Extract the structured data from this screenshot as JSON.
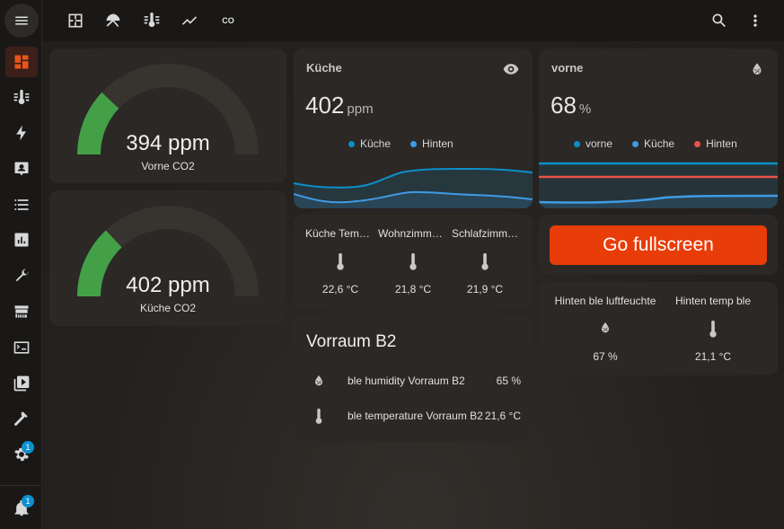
{
  "toolbar": {
    "icons": [
      "floorplan-icon",
      "umbrella-icon",
      "thermometer-icon",
      "chart-line-icon",
      "co2-icon",
      "search-icon",
      "more-vertical-icon"
    ],
    "co2_text": "CO"
  },
  "sidebar": {
    "items": [
      {
        "icon": "dashboard-icon",
        "active": true
      },
      {
        "icon": "thermometer-lines-icon"
      },
      {
        "icon": "energy-icon"
      },
      {
        "icon": "account-box-icon"
      },
      {
        "icon": "list-icon"
      },
      {
        "icon": "chart-box-icon"
      },
      {
        "icon": "wrench-icon"
      },
      {
        "icon": "hacs-store-icon"
      },
      {
        "icon": "console-icon"
      },
      {
        "icon": "media-icon"
      },
      {
        "icon": "hammer-icon"
      },
      {
        "icon": "settings-icon",
        "badge": "1"
      }
    ],
    "notifications": {
      "icon": "bell-icon",
      "badge": "1"
    }
  },
  "gauges": [
    {
      "value": "394 ppm",
      "name": "Vorne CO2",
      "fraction": 0.24
    },
    {
      "value": "402 ppm",
      "name": "Küche CO2",
      "fraction": 0.26
    }
  ],
  "graph_kueche": {
    "title": "Küche",
    "value": "402",
    "unit": "ppm",
    "legend": [
      {
        "name": "Küche",
        "color": "#0b8fc8"
      },
      {
        "name": "Hinten",
        "color": "#3f9be4"
      }
    ]
  },
  "graph_vorne": {
    "title": "vorne",
    "value": "68",
    "unit": "%",
    "legend": [
      {
        "name": "vorne",
        "color": "#0b8fc8"
      },
      {
        "name": "Küche",
        "color": "#3f9be4"
      },
      {
        "name": "Hinten",
        "color": "#e8534a"
      }
    ]
  },
  "temps": [
    {
      "name": "Küche Temp…",
      "value": "22,6 °C"
    },
    {
      "name": "Wohnzimme…",
      "value": "21,8 °C"
    },
    {
      "name": "Schlafzimm…",
      "value": "21,9 °C"
    }
  ],
  "fullscreen": {
    "label": "Go fullscreen"
  },
  "hinten": [
    {
      "name": "Hinten ble luftfeuchte",
      "value": "67 %"
    },
    {
      "name": "Hinten temp ble",
      "value": "21,1 °C"
    }
  ],
  "vorraum": {
    "title": "Vorraum B2",
    "rows": [
      {
        "name": "ble humidity Vorraum B2",
        "value": "65 %"
      },
      {
        "name": "ble temperature Vorraum B2",
        "value": "21,6 °C"
      }
    ]
  },
  "colors": {
    "accent": "#e83c09",
    "gauge_green": "#43a047",
    "gauge_track": "#37332f",
    "card": "#2b2826"
  }
}
